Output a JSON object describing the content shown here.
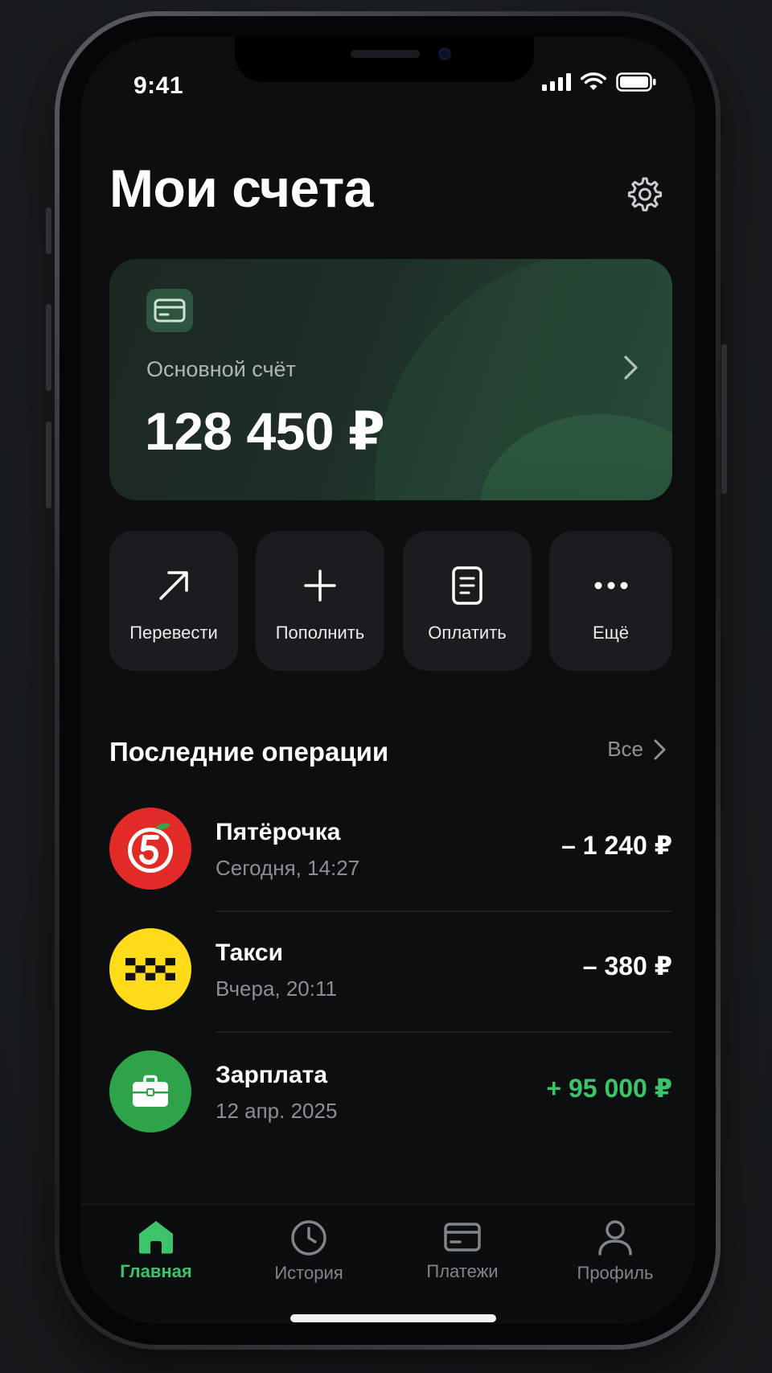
{
  "status_bar": {
    "time": "9:41"
  },
  "header": {
    "title": "Мои счета"
  },
  "account": {
    "label": "Основной счёт",
    "balance": "128 450 ₽"
  },
  "actions": [
    {
      "label": "Перевести",
      "icon": "arrow-up-right-icon"
    },
    {
      "label": "Пополнить",
      "icon": "plus-icon"
    },
    {
      "label": "Оплатить",
      "icon": "receipt-icon"
    },
    {
      "label": "Ещё",
      "icon": "more-icon"
    }
  ],
  "recent": {
    "title": "Последние операции",
    "see_all": "Все",
    "items": [
      {
        "name": "Пятёрочка",
        "date": "Сегодня, 14:27",
        "amount": "– 1 240 ₽",
        "type": "debit",
        "avatar_color": "#e22b26"
      },
      {
        "name": "Такси",
        "date": "Вчера, 20:11",
        "amount": "– 380 ₽",
        "type": "debit",
        "avatar_color": "#ffdb1a"
      },
      {
        "name": "Зарплата",
        "date": "12 апр. 2025",
        "amount": "+ 95 000 ₽",
        "type": "credit",
        "avatar_color": "#2ea34a"
      }
    ]
  },
  "tabs": [
    {
      "label": "Главная",
      "icon": "home-icon",
      "active": true
    },
    {
      "label": "История",
      "icon": "clock-icon",
      "active": false
    },
    {
      "label": "Платежи",
      "icon": "card-icon",
      "active": false
    },
    {
      "label": "Профиль",
      "icon": "user-icon",
      "active": false
    }
  ],
  "colors": {
    "accent": "#3cc46a",
    "background": "#0d0e10",
    "card": "#1a1c1f"
  }
}
